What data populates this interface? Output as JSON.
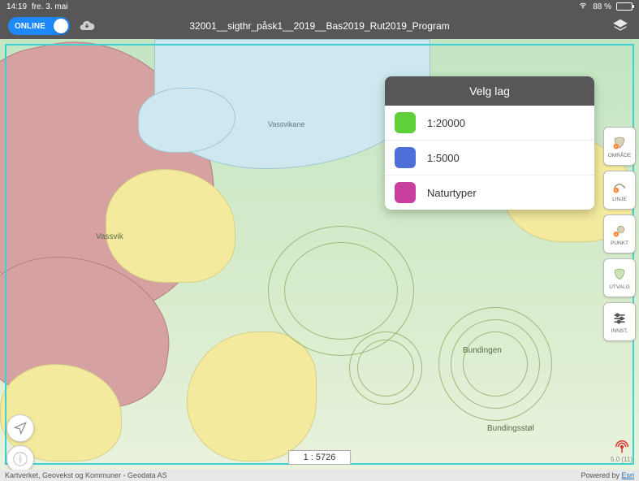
{
  "status": {
    "time": "14:19",
    "date": "fre. 3. mai",
    "battery_pct": "88 %"
  },
  "header": {
    "online_label": "ONLINE",
    "title": "32001__sigthr_påsk1__2019__Bas2019_Rut2019_Program"
  },
  "layer_panel": {
    "title": "Velg lag",
    "items": [
      {
        "label": "1:20000",
        "color": "#5fcf3a"
      },
      {
        "label": "1:5000",
        "color": "#4f6fd8"
      },
      {
        "label": "Naturtyper",
        "color": "#c93fa0"
      }
    ]
  },
  "side_tools": [
    {
      "name": "omrade",
      "label": "OMRÅDE"
    },
    {
      "name": "linje",
      "label": "LINJE"
    },
    {
      "name": "punkt",
      "label": "PUNKT"
    },
    {
      "name": "utvalg",
      "label": "UTVALG"
    },
    {
      "name": "innst",
      "label": "INNST."
    }
  ],
  "map": {
    "place_vassvik": "Vassvik",
    "place_bundingen": "Bundingen",
    "place_bundingsstol": "Bundingsstøl",
    "lake_vassvikane": "Vassvikane",
    "scale_label": "1 : 5726"
  },
  "precision": {
    "value": "5.0 (11)"
  },
  "attribution": {
    "left": "Kartverket, Geovekst og Kommuner - Geodata AS",
    "right_prefix": "Powered by ",
    "right_link": "Esri"
  }
}
